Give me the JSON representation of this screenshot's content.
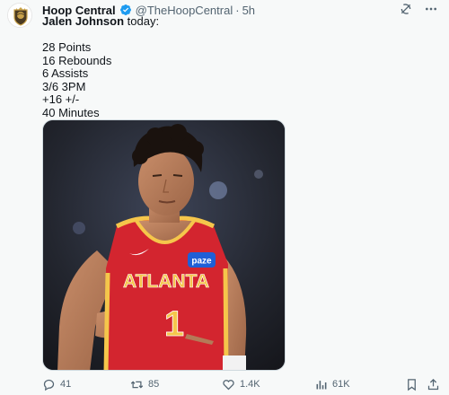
{
  "author": {
    "display_name": "Hoop Central",
    "handle": "@TheHoopCentral",
    "separator": "·",
    "time": "5h"
  },
  "post": {
    "first_line_bold": "Jalen Johnson",
    "first_line_rest": " today:",
    "stats": [
      "28 Points",
      "16 Rebounds",
      "6 Assists",
      "3/6 3PM",
      "+16 +/-",
      "40 Minutes"
    ]
  },
  "media": {
    "jersey_text": "ATLANTA",
    "jersey_number": "1",
    "sponsor_patch": "paze"
  },
  "actions": {
    "replies": "41",
    "reposts": "85",
    "likes": "1.4K",
    "views": "61K"
  },
  "icons": {
    "avatar": "hoop-central-logo",
    "verified": "verified-badge-icon",
    "grok": "grok-icon",
    "more": "more-options-icon",
    "reply": "reply-icon",
    "repost": "repost-icon",
    "like": "heart-icon",
    "views": "views-icon",
    "bookmark": "bookmark-icon",
    "share": "share-icon"
  },
  "colors": {
    "verified": "#1d9bf0",
    "text": "#0f1419",
    "secondary": "#536471",
    "jersey_red": "#d3252f",
    "jersey_gold": "#f5c64b"
  }
}
